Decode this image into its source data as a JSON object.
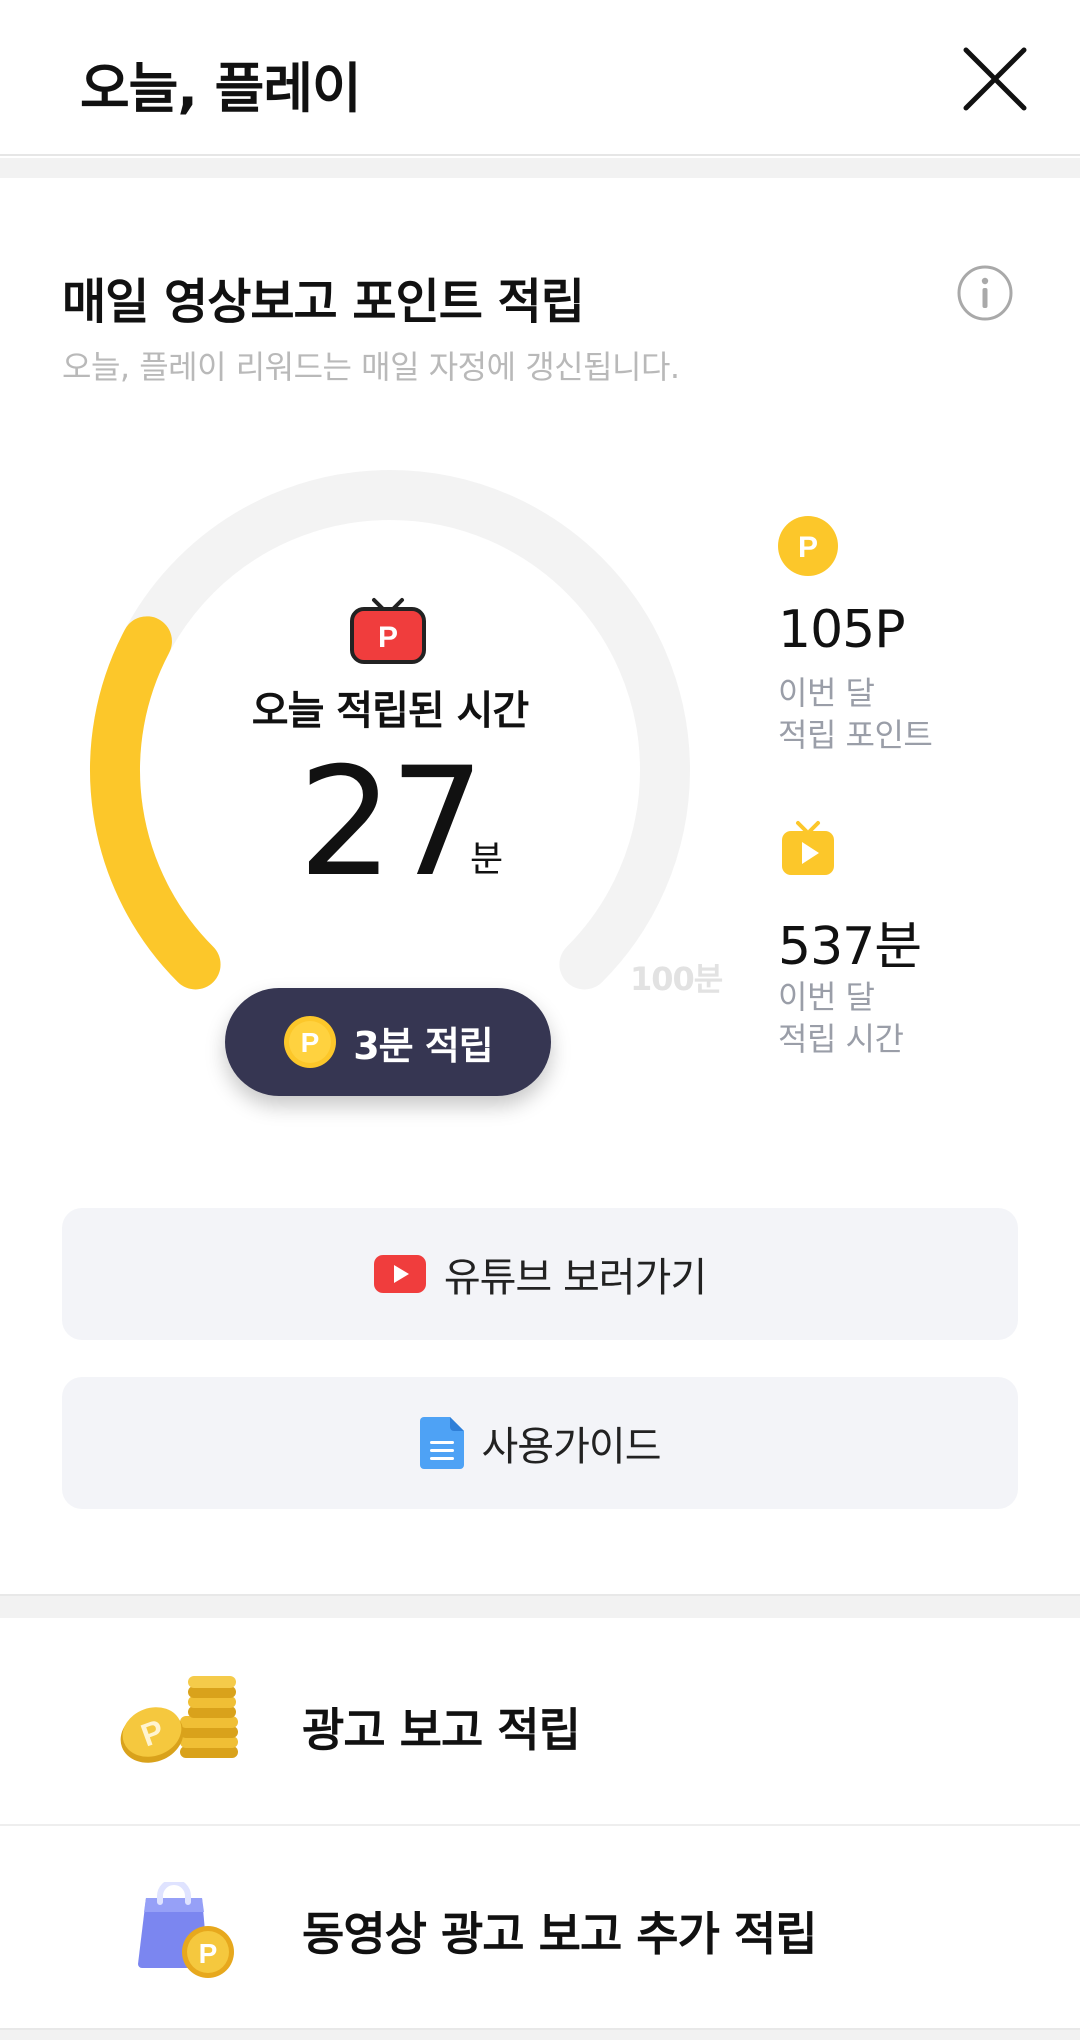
{
  "header": {
    "title": "오늘, 플레이"
  },
  "section": {
    "title": "매일 영상보고 포인트 적립",
    "subtitle": "오늘, 플레이 리워드는 매일 자정에 갱신됩니다."
  },
  "gauge": {
    "label": "오늘 적립된 시간",
    "value": "27",
    "unit": "분",
    "max_label": "100분",
    "progress_minutes": 27,
    "max_minutes": 100,
    "track_color": "#f3f3f3",
    "fill_color": "#fcc72a",
    "icon": "tv-point-icon"
  },
  "claim_button": {
    "coin_letter": "P",
    "label": "3분 적립"
  },
  "stats": [
    {
      "icon": "point-coin-icon",
      "icon_letter": "P",
      "value": "105P",
      "desc_line1": "이번 달",
      "desc_line2": "적립 포인트"
    },
    {
      "icon": "tv-play-icon",
      "value": "537분",
      "desc_line1": "이번 달",
      "desc_line2": "적립 시간"
    }
  ],
  "actions": [
    {
      "icon": "youtube-icon",
      "label": "유튜브 보러가기"
    },
    {
      "icon": "document-icon",
      "label": "사용가이드"
    }
  ],
  "rewards": [
    {
      "icon": "coin-stack-icon",
      "coin_letter": "P",
      "label": "광고 보고 적립"
    },
    {
      "icon": "shopping-bag-coin-icon",
      "coin_letter": "P",
      "label": "동영상 광고 보고 추가 적립"
    }
  ],
  "colors": {
    "accent": "#fcc72a",
    "button_dark": "#363652",
    "youtube_red": "#f03d3d",
    "doc_blue": "#4ea2f5"
  }
}
